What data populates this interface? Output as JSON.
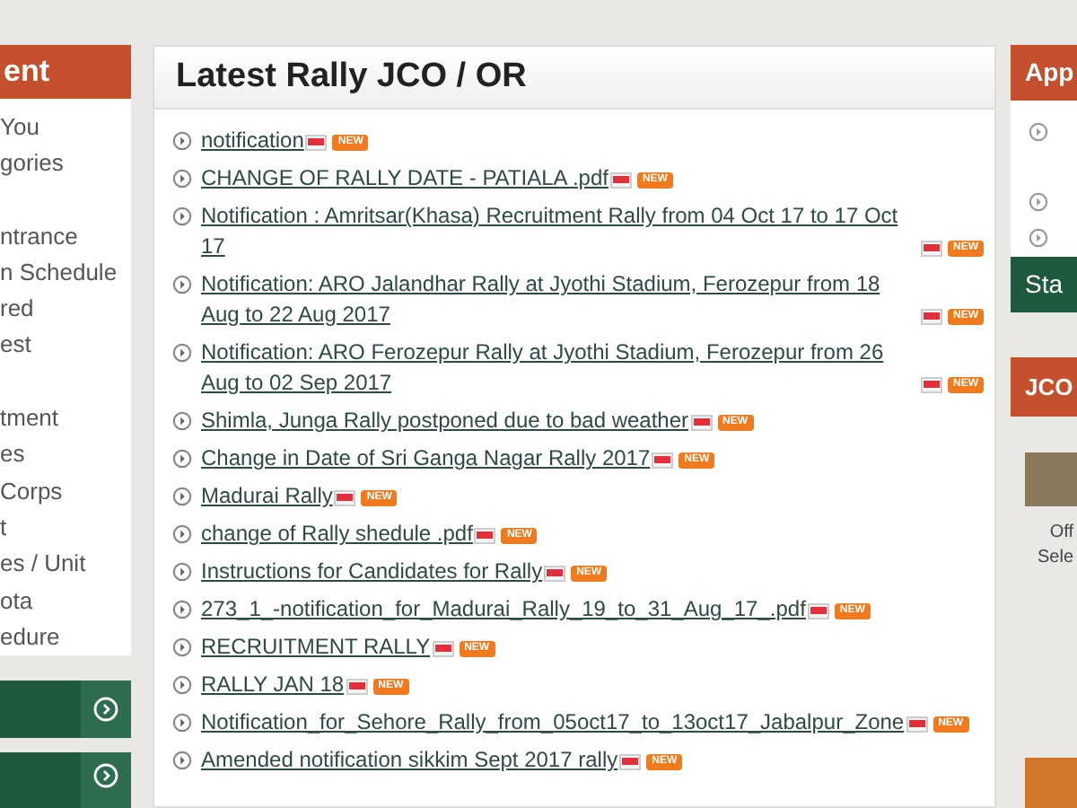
{
  "left_panel": {
    "title": "ent",
    "items": [
      {
        "text": "You",
        "gap_before": false
      },
      {
        "text": "gories",
        "gap_before": false
      },
      {
        "text": "ntrance",
        "gap_before": true
      },
      {
        "text": "n Schedule",
        "gap_before": false
      },
      {
        "text": "red",
        "gap_before": false
      },
      {
        "text": "est",
        "gap_before": false
      },
      {
        "text": "tment",
        "gap_before": true
      },
      {
        "text": "es",
        "gap_before": false
      },
      {
        "text": "Corps",
        "gap_before": false
      },
      {
        "text": "t",
        "gap_before": false
      },
      {
        "text": "es / Unit",
        "gap_before": false
      },
      {
        "text": "ota",
        "gap_before": false
      },
      {
        "text": "edure",
        "gap_before": false
      }
    ]
  },
  "main_panel": {
    "title": "Latest Rally JCO / OR",
    "items": [
      {
        "text": "notification",
        "badge": "NEW"
      },
      {
        "text": "CHANGE OF RALLY DATE - PATIALA .pdf",
        "badge": "NEW"
      },
      {
        "text": "Notification : Amritsar(Khasa) Recruitment Rally from 04 Oct 17 to 17 Oct 17",
        "badge": "NEW"
      },
      {
        "text": "Notification: ARO Jalandhar Rally at Jyothi Stadium, Ferozepur from 18 Aug to 22 Aug 2017",
        "badge": "NEW"
      },
      {
        "text": "Notification: ARO Ferozepur Rally at Jyothi Stadium, Ferozepur from 26 Aug to 02 Sep 2017",
        "badge": "NEW"
      },
      {
        "text": "Shimla, Junga Rally postponed due to bad weather",
        "badge": "NEW"
      },
      {
        "text": "Change in Date of Sri Ganga Nagar Rally 2017",
        "badge": "NEW"
      },
      {
        "text": "Madurai Rally",
        "badge": "NEW"
      },
      {
        "text": "change of Rally shedule .pdf",
        "badge": "NEW"
      },
      {
        "text": "Instructions for Candidates for Rally",
        "badge": "NEW"
      },
      {
        "text": "273_1_-notification_for_Madurai_Rally_19_to_31_Aug_17_.pdf",
        "badge": "NEW"
      },
      {
        "text": "RECRUITMENT RALLY",
        "badge": "NEW"
      },
      {
        "text": "RALLY JAN 18",
        "badge": "NEW"
      },
      {
        "text": "Notification_for_Sehore_Rally_from_05oct17_to_13oct17_Jabalpur_Zone",
        "badge": "NEW"
      },
      {
        "text": "Amended notification sikkim Sept 2017 rally",
        "badge": "NEW"
      }
    ]
  },
  "right_panel": {
    "title": "App",
    "nav_bar": "Sta",
    "second_title": "JCO",
    "caption": [
      "Off",
      "Sele"
    ]
  }
}
